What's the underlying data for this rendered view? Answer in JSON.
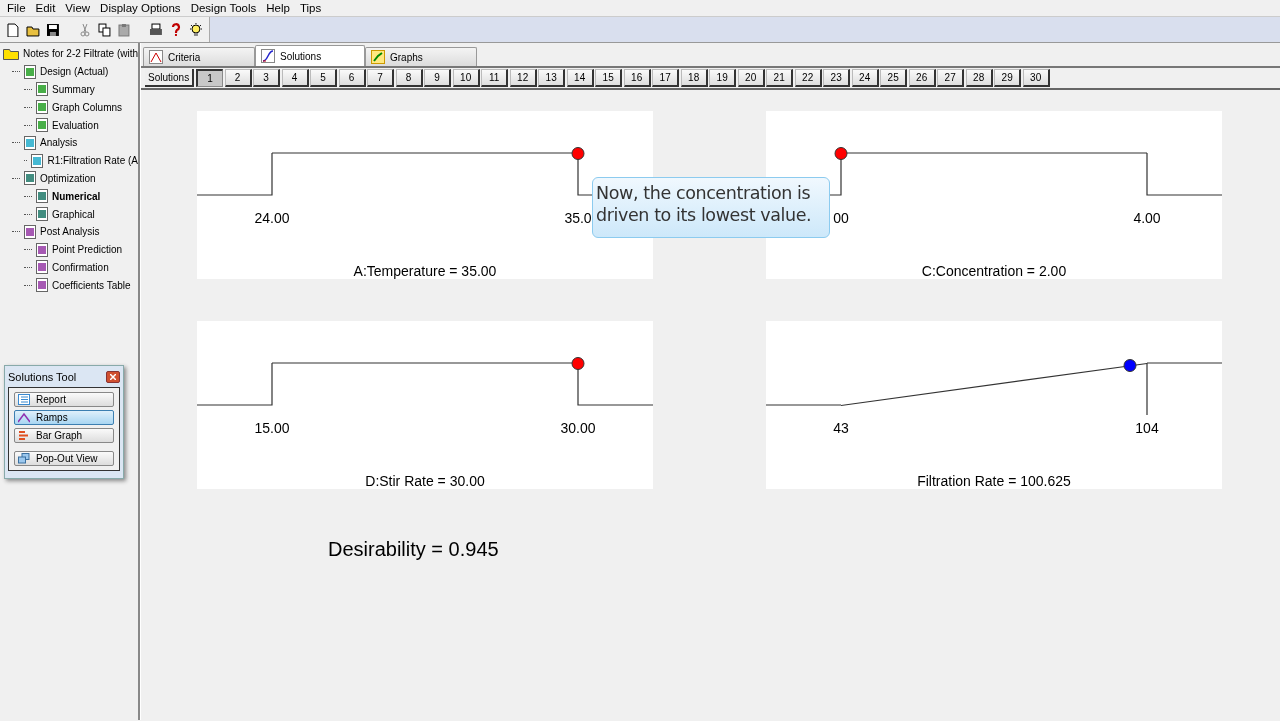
{
  "menu": [
    "File",
    "Edit",
    "View",
    "Display Options",
    "Design Tools",
    "Help",
    "Tips"
  ],
  "tree": {
    "label": "Notes for 2-2 Filtrate (with",
    "selected": false,
    "children": [
      {
        "label": "Design (Actual)",
        "selected": false,
        "children": [
          {
            "label": "Summary",
            "selected": false
          },
          {
            "label": "Graph Columns",
            "selected": false
          },
          {
            "label": "Evaluation",
            "selected": false
          }
        ]
      },
      {
        "label": "Analysis",
        "selected": false,
        "children": [
          {
            "label": "R1:Filtration Rate (A",
            "selected": false
          }
        ]
      },
      {
        "label": "Optimization",
        "selected": false,
        "children": [
          {
            "label": "Numerical",
            "selected": true
          },
          {
            "label": "Graphical",
            "selected": false
          }
        ]
      },
      {
        "label": "Post Analysis",
        "selected": false,
        "children": [
          {
            "label": "Point Prediction",
            "selected": false
          },
          {
            "label": "Confirmation",
            "selected": false
          },
          {
            "label": "Coefficients Table",
            "selected": false
          }
        ]
      }
    ]
  },
  "solutions_tool": {
    "title": "Solutions Tool",
    "buttons": [
      {
        "label": "Report",
        "selected": false
      },
      {
        "label": "Ramps",
        "selected": true
      },
      {
        "label": "Bar Graph",
        "selected": false
      },
      {
        "label": "Pop-Out View",
        "selected": false
      }
    ]
  },
  "tabs": [
    {
      "label": "Criteria",
      "selected": false
    },
    {
      "label": "Solutions",
      "selected": true
    },
    {
      "label": "Graphs",
      "selected": false
    }
  ],
  "solutions_label": "Solutions",
  "solutions": [
    {
      "label": "1",
      "selected": true
    },
    {
      "label": "2",
      "selected": false
    },
    {
      "label": "3",
      "selected": false
    },
    {
      "label": "4",
      "selected": false
    },
    {
      "label": "5",
      "selected": false
    },
    {
      "label": "6",
      "selected": false
    },
    {
      "label": "7",
      "selected": false
    },
    {
      "label": "8",
      "selected": false
    },
    {
      "label": "9",
      "selected": false
    },
    {
      "label": "10",
      "selected": false
    },
    {
      "label": "11",
      "selected": false
    },
    {
      "label": "12",
      "selected": false
    },
    {
      "label": "13",
      "selected": false
    },
    {
      "label": "14",
      "selected": false
    },
    {
      "label": "15",
      "selected": false
    },
    {
      "label": "16",
      "selected": false
    },
    {
      "label": "17",
      "selected": false
    },
    {
      "label": "18",
      "selected": false
    },
    {
      "label": "19",
      "selected": false
    },
    {
      "label": "20",
      "selected": false
    },
    {
      "label": "21",
      "selected": false
    },
    {
      "label": "22",
      "selected": false
    },
    {
      "label": "23",
      "selected": false
    },
    {
      "label": "24",
      "selected": false
    },
    {
      "label": "25",
      "selected": false
    },
    {
      "label": "26",
      "selected": false
    },
    {
      "label": "27",
      "selected": false
    },
    {
      "label": "28",
      "selected": false
    },
    {
      "label": "29",
      "selected": false
    },
    {
      "label": "30",
      "selected": false
    }
  ],
  "ramps": [
    {
      "kind": "step",
      "low": "24.00",
      "high": "35.0",
      "title": "A:Temperature = 35.00",
      "level": 1,
      "color": "#ff0000"
    },
    {
      "kind": "step",
      "low": "00",
      "high": "4.00",
      "title": "C:Concentration = 2.00",
      "level": 0,
      "color": "#ff0000"
    },
    {
      "kind": "step",
      "low": "15.00",
      "high": "30.00",
      "title": "D:Stir Rate = 30.00",
      "level": 1,
      "color": "#ff0000"
    },
    {
      "kind": "ramp",
      "low": "43",
      "high": "104",
      "title": "Filtration Rate = 100.625",
      "level": 0.945,
      "color": "#0000ff"
    }
  ],
  "callout": {
    "lines": [
      "Now, the concentration is",
      "driven to its lowest value."
    ]
  },
  "desirability": "Desirability = 0.945"
}
